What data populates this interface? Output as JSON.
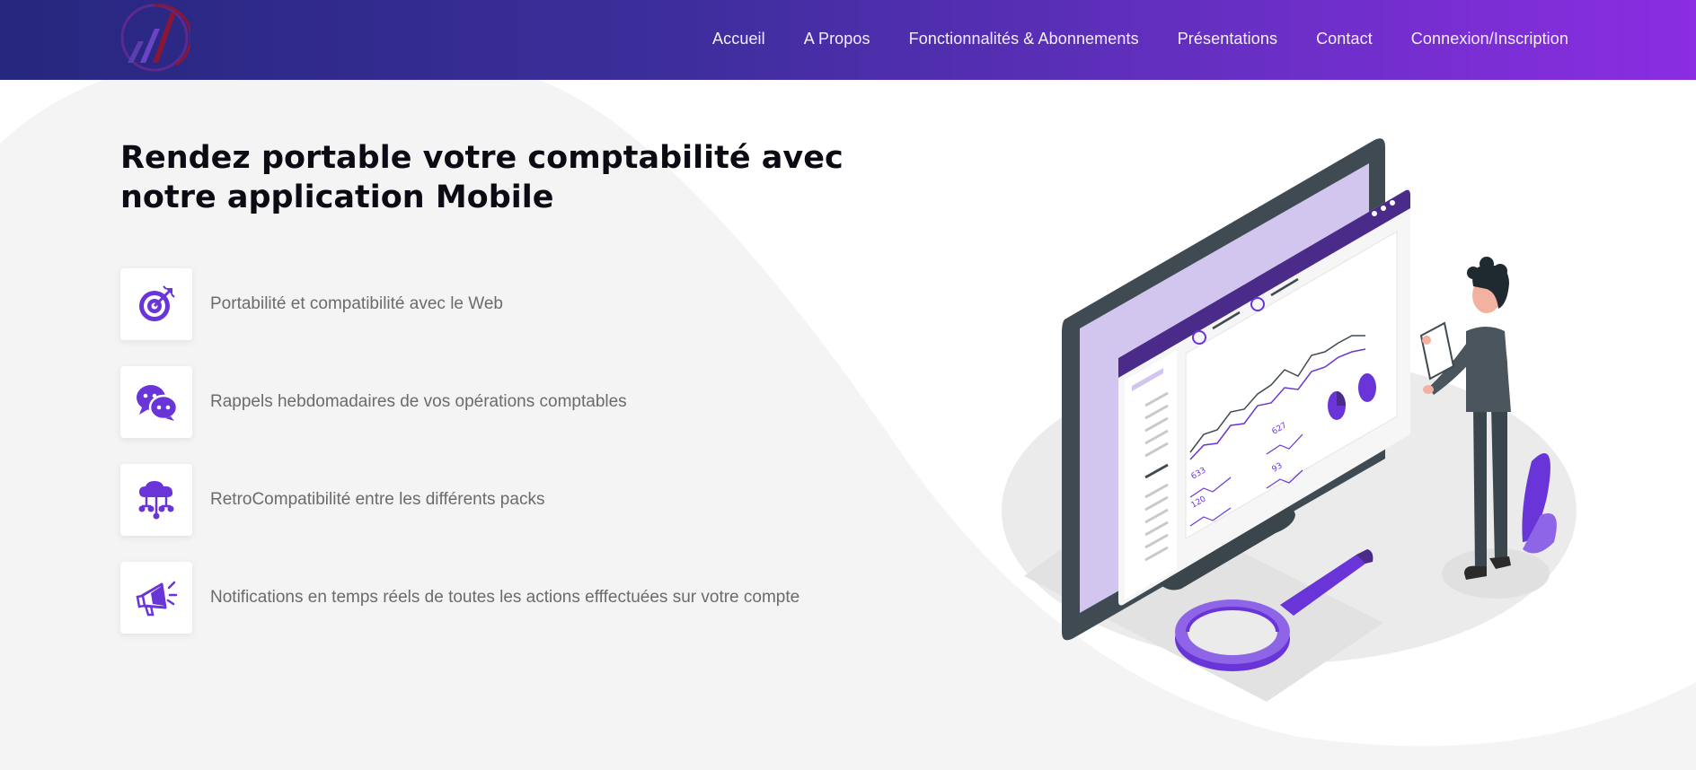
{
  "nav": {
    "logo_icon": "chart-logo-icon",
    "items": [
      {
        "label": "Accueil"
      },
      {
        "label": "A Propos"
      },
      {
        "label": "Fonctionnalités & Abonnements"
      },
      {
        "label": "Présentations"
      },
      {
        "label": "Contact"
      },
      {
        "label": "Connexion/Inscription"
      }
    ]
  },
  "hero": {
    "title_line1": "Rendez portable votre comptabilité avec",
    "title_line2": "notre application Mobile"
  },
  "features": [
    {
      "icon": "target-icon",
      "text": "Portabilité et compatibilité avec le Web"
    },
    {
      "icon": "chat-bubbles-icon",
      "text": "Rappels hebdomadaires de vos opérations comptables"
    },
    {
      "icon": "cloud-network-icon",
      "text": "RetroCompatibilité entre les différents packs"
    },
    {
      "icon": "megaphone-icon",
      "text": "Notifications en temps réels de toutes les actions efffectuées sur votre compte"
    }
  ],
  "illustration": {
    "values": [
      "627",
      "633",
      "93",
      "120"
    ]
  },
  "colors": {
    "accent": "#6a35d8",
    "nav_start": "#26277e",
    "nav_end": "#8b2de2",
    "background_wave": "#f4f4f4",
    "text_dark": "#0b0b14",
    "text_muted": "#6b6b6b"
  }
}
